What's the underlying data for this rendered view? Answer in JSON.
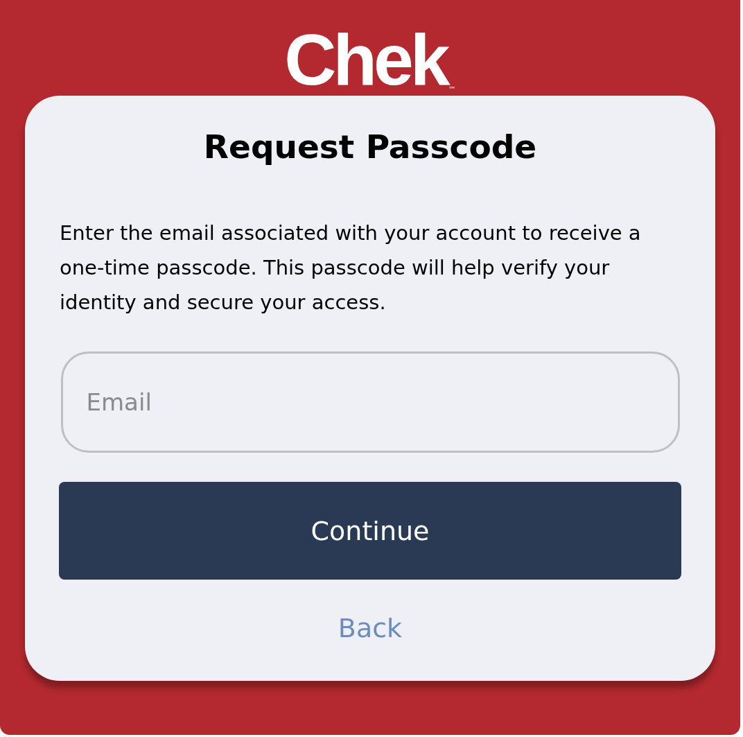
{
  "logo": {
    "text": "Chek",
    "mark": "™"
  },
  "card": {
    "title": "Request Passcode",
    "description": "Enter the email associated with your account to receive a one-time passcode. This passcode will help verify your identity and secure your access.",
    "email_field": {
      "placeholder": "Email"
    },
    "continue_button": "Continue",
    "back_link": "Back"
  }
}
